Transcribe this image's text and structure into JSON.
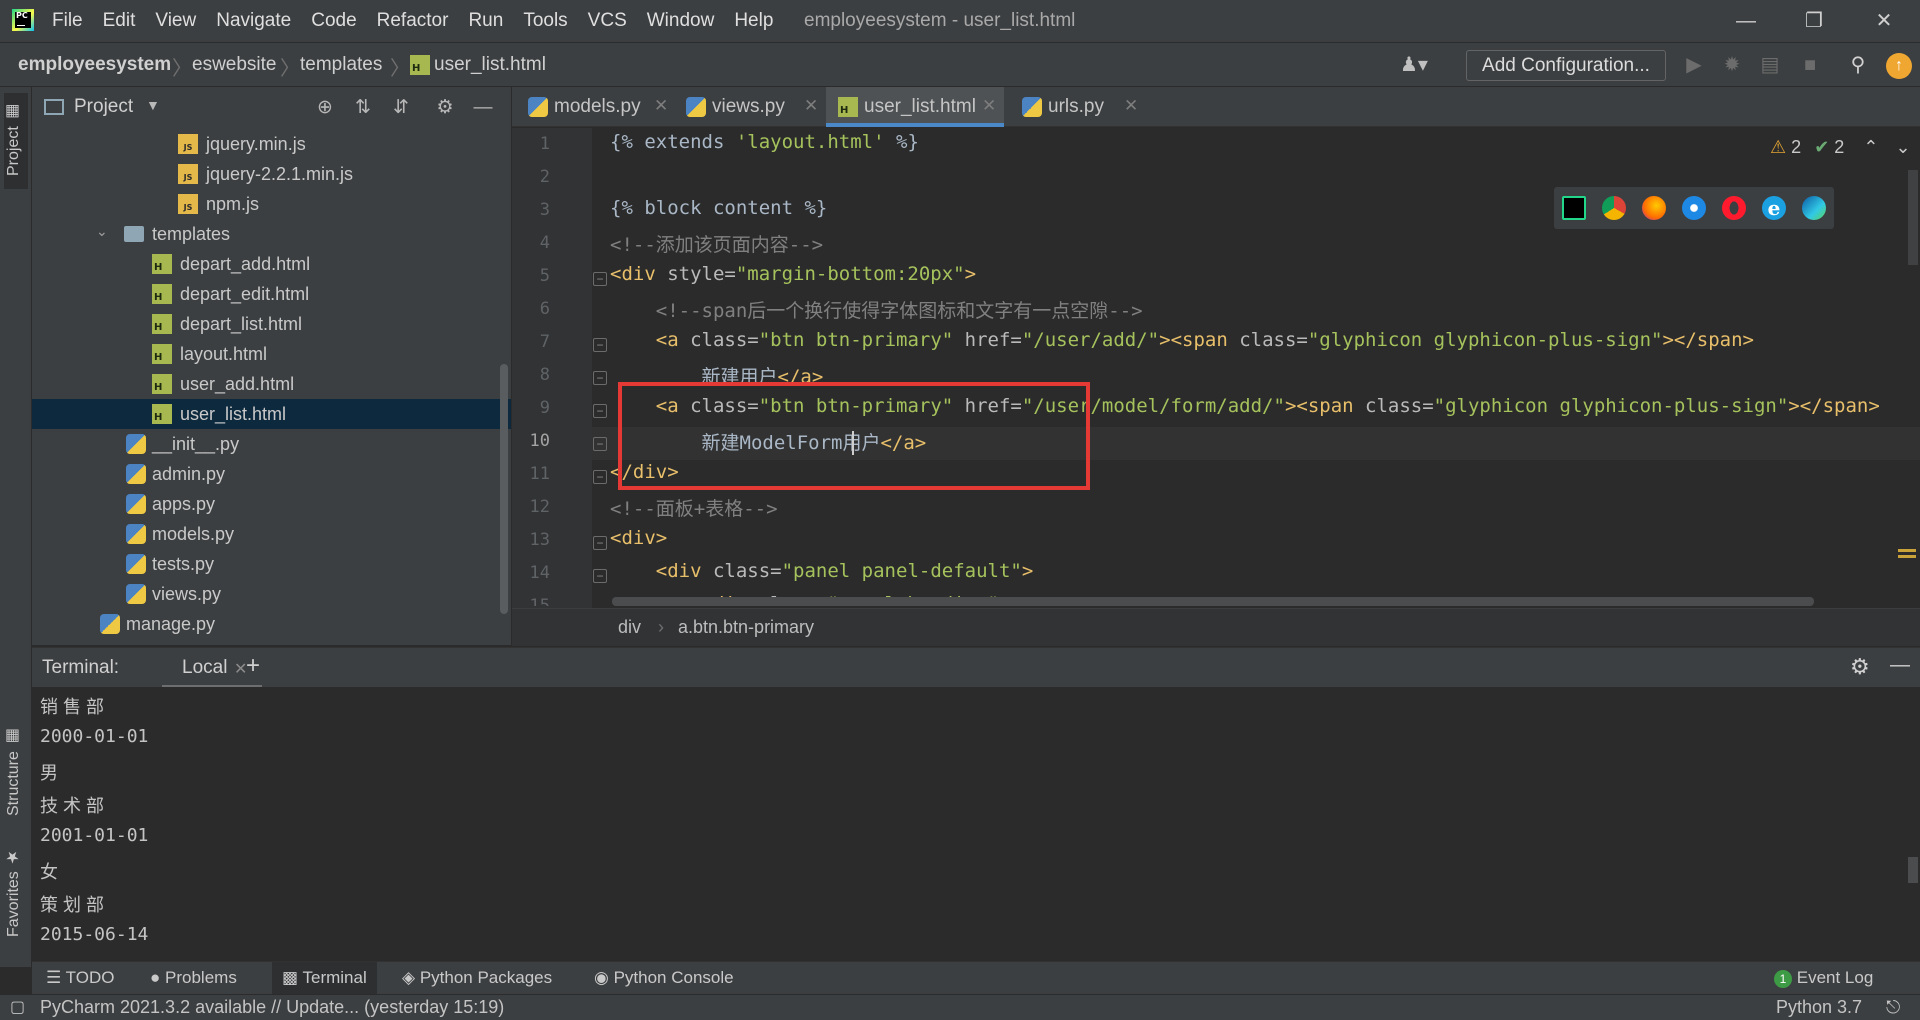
{
  "window": {
    "title": "employeesystem - user_list.html"
  },
  "menu": [
    "File",
    "Edit",
    "View",
    "Navigate",
    "Code",
    "Refactor",
    "Run",
    "Tools",
    "VCS",
    "Window",
    "Help"
  ],
  "breadcrumbs": [
    "employeesystem",
    "eswebsite",
    "templates",
    "user_list.html"
  ],
  "toolbar": {
    "add_configuration": "Add Configuration..."
  },
  "left_stripe": {
    "project": "Project",
    "structure": "Structure",
    "favorites": "Favorites"
  },
  "project_panel": {
    "title": "Project",
    "items": [
      {
        "label": "jquery.min.js",
        "type": "js",
        "depth": 3
      },
      {
        "label": "jquery-2.2.1.min.js",
        "type": "js",
        "depth": 3
      },
      {
        "label": "npm.js",
        "type": "js",
        "depth": 3
      },
      {
        "label": "templates",
        "type": "folder",
        "depth": 2
      },
      {
        "label": "depart_add.html",
        "type": "html",
        "depth": 3
      },
      {
        "label": "depart_edit.html",
        "type": "html",
        "depth": 3
      },
      {
        "label": "depart_list.html",
        "type": "html",
        "depth": 3
      },
      {
        "label": "layout.html",
        "type": "html",
        "depth": 3
      },
      {
        "label": "user_add.html",
        "type": "html",
        "depth": 3
      },
      {
        "label": "user_list.html",
        "type": "html",
        "depth": 3,
        "selected": true
      },
      {
        "label": "__init__.py",
        "type": "py",
        "depth": 2
      },
      {
        "label": "admin.py",
        "type": "py",
        "depth": 2
      },
      {
        "label": "apps.py",
        "type": "py",
        "depth": 2
      },
      {
        "label": "models.py",
        "type": "py",
        "depth": 2
      },
      {
        "label": "tests.py",
        "type": "py",
        "depth": 2
      },
      {
        "label": "views.py",
        "type": "py",
        "depth": 2
      },
      {
        "label": "manage.py",
        "type": "py",
        "depth": 1
      }
    ]
  },
  "editor": {
    "tabs": [
      {
        "label": "models.py",
        "type": "py"
      },
      {
        "label": "views.py",
        "type": "py"
      },
      {
        "label": "user_list.html",
        "type": "html",
        "active": true
      },
      {
        "label": "urls.py",
        "type": "py"
      }
    ],
    "line_numbers": [
      "1",
      "2",
      "3",
      "4",
      "5",
      "6",
      "7",
      "8",
      "9",
      "10",
      "11",
      "12",
      "13",
      "14",
      "15"
    ],
    "warnings": "2",
    "checks": "2",
    "breadcrumb": [
      "div",
      "a.btn.btn-primary"
    ]
  },
  "terminal": {
    "title": "Terminal:",
    "tab": "Local",
    "lines": [
      "销 售 部",
      "2000-01-01",
      "男",
      "技 术 部",
      "2001-01-01",
      "女",
      "策 划 部",
      "2015-06-14"
    ]
  },
  "bottom_tools": [
    "TODO",
    "Problems",
    "Terminal",
    "Python Packages",
    "Python Console"
  ],
  "event_log": {
    "count": "1",
    "label": "Event Log"
  },
  "status": {
    "message": "PyCharm 2021.3.2 available // Update... (yesterday 15:19)",
    "interpreter": "Python 3.7"
  }
}
